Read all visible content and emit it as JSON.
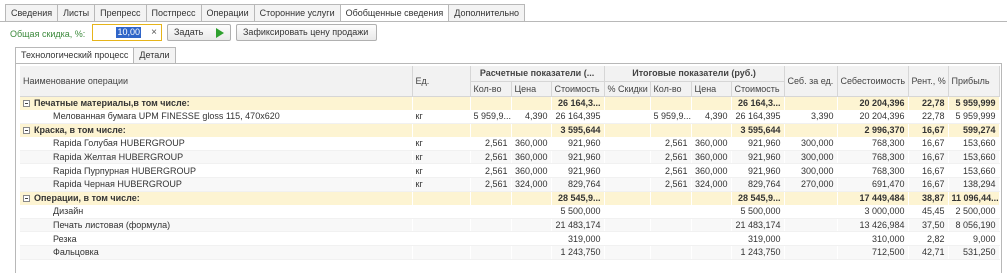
{
  "top_tabs": [
    "Сведения",
    "Листы",
    "Препресс",
    "Постпресс",
    "Операции",
    "Сторонние услуги",
    "Обобщенные сведения",
    "Дополнительно"
  ],
  "discount": {
    "label": "Общая скидка, %:",
    "value": "10,00",
    "clear": "×",
    "set_button": "Задать",
    "fix_button": "Зафиксировать цену продажи"
  },
  "inner_tabs": [
    "Технологический процесс",
    "Детали"
  ],
  "table": {
    "headers": {
      "name": "Наименование операции",
      "unit": "Ед.",
      "calc_group": "Расчетные показатели (...",
      "final_group": "Итоговые показатели (руб.)",
      "cost_per_unit": "Себ. за ед.",
      "cost_price": "Себестоимость",
      "profitability": "Рент., %",
      "profit": "Прибыль",
      "qty": "Кол-во",
      "price": "Цена",
      "cost": "Стоимость",
      "discount_pct": "% Скидки",
      "qty2": "Кол-во",
      "price2": "Цена",
      "cost2": "Стоимость"
    },
    "rows": [
      {
        "type": "group",
        "name": "Печатные материалы,в том числе:",
        "unit": "",
        "qty": "",
        "price": "",
        "cost": "26 164,3...",
        "disc": "",
        "qty2": "",
        "price2": "",
        "cost2": "26 164,3...",
        "unitcost": "",
        "costprice": "20 204,396",
        "rent": "22,78",
        "profit": "5 959,999"
      },
      {
        "type": "child",
        "name": "Мелованная бумага UPM FINESSE gloss 115, 470x620",
        "unit": "кг",
        "qty": "5 959,9...",
        "price": "4,390",
        "cost": "26 164,395",
        "disc": "",
        "qty2": "5 959,9...",
        "price2": "4,390",
        "cost2": "26 164,395",
        "unitcost": "3,390",
        "costprice": "20 204,396",
        "rent": "22,78",
        "profit": "5 959,999"
      },
      {
        "type": "group",
        "name": "Краска, в том числе:",
        "unit": "",
        "qty": "",
        "price": "",
        "cost": "3 595,644",
        "disc": "",
        "qty2": "",
        "price2": "",
        "cost2": "3 595,644",
        "unitcost": "",
        "costprice": "2 996,370",
        "rent": "16,67",
        "profit": "599,274"
      },
      {
        "type": "child",
        "name": "Rapida Голубая HUBERGROUP",
        "unit": "кг",
        "qty": "2,561",
        "price": "360,000",
        "cost": "921,960",
        "disc": "",
        "qty2": "2,561",
        "price2": "360,000",
        "cost2": "921,960",
        "unitcost": "300,000",
        "costprice": "768,300",
        "rent": "16,67",
        "profit": "153,660"
      },
      {
        "type": "child",
        "name": "Rapida Желтая HUBERGROUP",
        "unit": "кг",
        "qty": "2,561",
        "price": "360,000",
        "cost": "921,960",
        "disc": "",
        "qty2": "2,561",
        "price2": "360,000",
        "cost2": "921,960",
        "unitcost": "300,000",
        "costprice": "768,300",
        "rent": "16,67",
        "profit": "153,660"
      },
      {
        "type": "child",
        "name": "Rapida Пурпурная HUBERGROUP",
        "unit": "кг",
        "qty": "2,561",
        "price": "360,000",
        "cost": "921,960",
        "disc": "",
        "qty2": "2,561",
        "price2": "360,000",
        "cost2": "921,960",
        "unitcost": "300,000",
        "costprice": "768,300",
        "rent": "16,67",
        "profit": "153,660"
      },
      {
        "type": "child",
        "name": "Rapida Черная HUBERGROUP",
        "unit": "кг",
        "qty": "2,561",
        "price": "324,000",
        "cost": "829,764",
        "disc": "",
        "qty2": "2,561",
        "price2": "324,000",
        "cost2": "829,764",
        "unitcost": "270,000",
        "costprice": "691,470",
        "rent": "16,67",
        "profit": "138,294"
      },
      {
        "type": "group",
        "name": "Операции, в том числе:",
        "unit": "",
        "qty": "",
        "price": "",
        "cost": "28 545,9...",
        "disc": "",
        "qty2": "",
        "price2": "",
        "cost2": "28 545,9...",
        "unitcost": "",
        "costprice": "17 449,484",
        "rent": "38,87",
        "profit": "11 096,44..."
      },
      {
        "type": "child",
        "name": "Дизайн",
        "unit": "",
        "qty": "",
        "price": "",
        "cost": "5 500,000",
        "disc": "",
        "qty2": "",
        "price2": "",
        "cost2": "5 500,000",
        "unitcost": "",
        "costprice": "3 000,000",
        "rent": "45,45",
        "profit": "2 500,000"
      },
      {
        "type": "child",
        "name": "Печать листовая (формула)",
        "unit": "",
        "qty": "",
        "price": "",
        "cost": "21 483,174",
        "disc": "",
        "qty2": "",
        "price2": "",
        "cost2": "21 483,174",
        "unitcost": "",
        "costprice": "13 426,984",
        "rent": "37,50",
        "profit": "8 056,190"
      },
      {
        "type": "child",
        "name": "Резка",
        "unit": "",
        "qty": "",
        "price": "",
        "cost": "319,000",
        "disc": "",
        "qty2": "",
        "price2": "",
        "cost2": "319,000",
        "unitcost": "",
        "costprice": "310,000",
        "rent": "2,82",
        "profit": "9,000"
      },
      {
        "type": "child",
        "name": "Фальцовка",
        "unit": "",
        "qty": "",
        "price": "",
        "cost": "1 243,750",
        "disc": "",
        "qty2": "",
        "price2": "",
        "cost2": "1 243,750",
        "unitcost": "",
        "costprice": "712,500",
        "rent": "42,71",
        "profit": "531,250"
      }
    ]
  }
}
